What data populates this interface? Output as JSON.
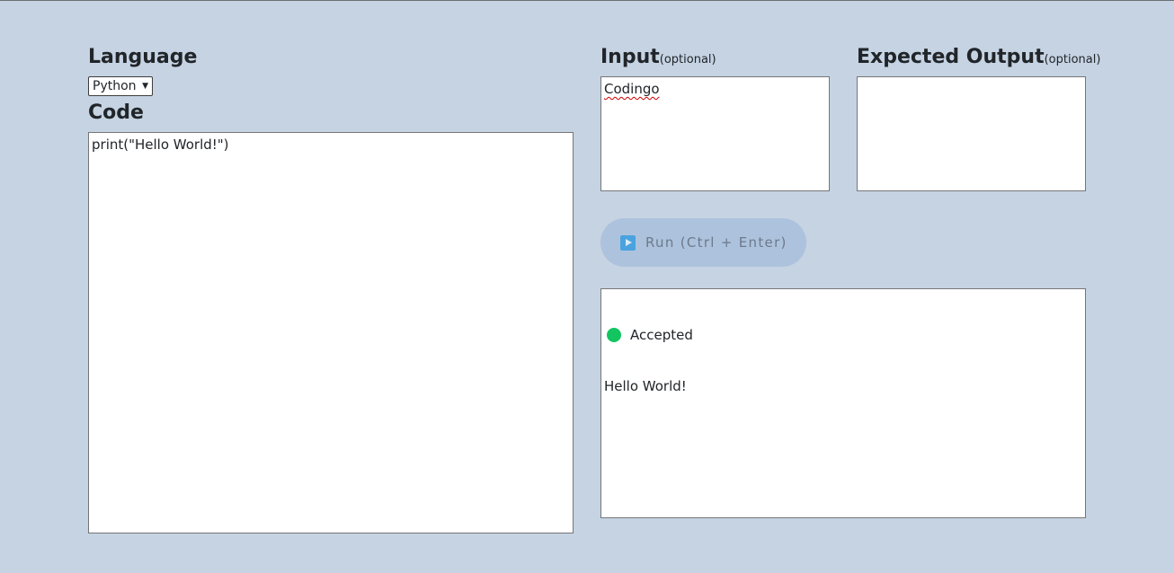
{
  "language": {
    "heading": "Language",
    "selected": "Python"
  },
  "code": {
    "heading": "Code",
    "value": "print(\"Hello World!\")"
  },
  "input": {
    "heading": "Input",
    "sub": "(optional)",
    "value": "Codingo"
  },
  "expected": {
    "heading": "Expected Output",
    "sub": "(optional)",
    "value": ""
  },
  "run": {
    "label": "Run (Ctrl + Enter)"
  },
  "result": {
    "status": "Accepted",
    "status_color": "#12c560",
    "output": "Hello World!"
  },
  "colors": {
    "background": "#c5d3e3",
    "run_button": "#adc2dc",
    "play_icon": "#4aa3df"
  }
}
